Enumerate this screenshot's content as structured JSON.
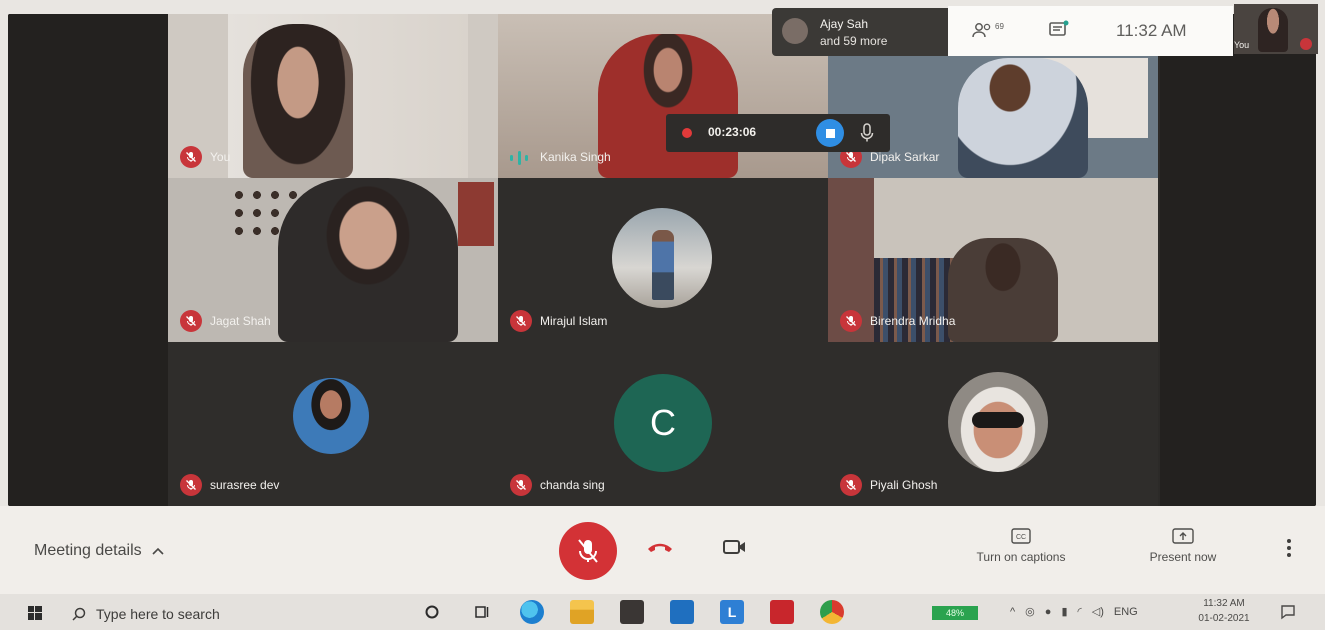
{
  "call": {
    "participants_preview": {
      "first_name": "Ajay Sah",
      "more_text": "and 59 more"
    },
    "people_count": "69",
    "clock": "11:32 AM",
    "self_label": "You",
    "recording_time": "00:23:06"
  },
  "tiles": [
    {
      "name": "You",
      "muted": true
    },
    {
      "name": "Kanika Singh",
      "muted": false,
      "speaking": true
    },
    {
      "name": "Dipak Sarkar",
      "muted": true
    },
    {
      "name": "Jagat Shah",
      "muted": true
    },
    {
      "name": "Mirajul Islam",
      "muted": true
    },
    {
      "name": "Birendra Mridha",
      "muted": true
    },
    {
      "name": "surasree dev",
      "muted": true
    },
    {
      "name": "chanda sing",
      "muted": true
    },
    {
      "name": "Piyali Ghosh",
      "muted": true
    }
  ],
  "avatar_letter": "C",
  "controls": {
    "meeting_details": "Meeting details",
    "captions": "Turn on captions",
    "present": "Present now"
  },
  "taskbar": {
    "search_placeholder": "Type here to search",
    "battery": "48%",
    "lang": "ENG",
    "time": "11:32 AM",
    "date": "01-02-2021"
  },
  "colors": {
    "mute_red": "#c8353a",
    "avatar_green": "#1e6654",
    "stop_blue": "#2f8ee4"
  }
}
